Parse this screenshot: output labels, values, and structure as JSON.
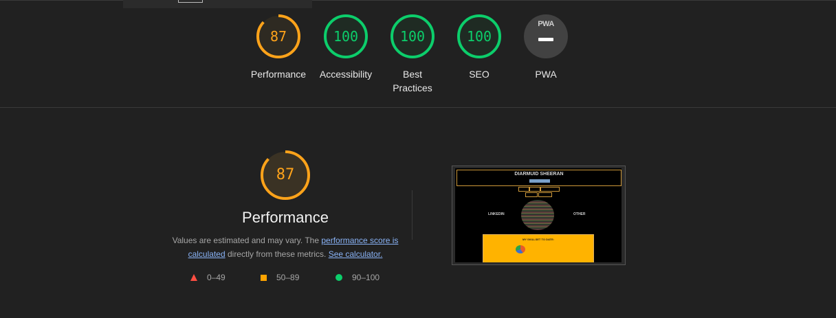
{
  "categories": [
    {
      "id": "performance",
      "score": "87",
      "label": "Performance",
      "value": 0.87,
      "color": "#ffa31a"
    },
    {
      "id": "accessibility",
      "score": "100",
      "label": "Accessibility",
      "value": 1.0,
      "color": "#0cce6b"
    },
    {
      "id": "best-practices",
      "score": "100",
      "label": "Best Practices",
      "value": 1.0,
      "color": "#0cce6b"
    },
    {
      "id": "seo",
      "score": "100",
      "label": "SEO",
      "value": 1.0,
      "color": "#0cce6b"
    },
    {
      "id": "pwa",
      "badge": "PWA",
      "label": "PWA",
      "icon": "pwa-dash-icon"
    }
  ],
  "performance": {
    "score": "87",
    "value": 0.87,
    "title": "Performance",
    "desc_prefix": "Values are estimated and may vary. The ",
    "link_score": "performance score is calculated",
    "desc_middle": " directly from these metrics. ",
    "link_calc": "See calculator."
  },
  "legend": [
    {
      "icon": "red-triangle-icon",
      "range": "0–49",
      "color": "#ff4e42"
    },
    {
      "icon": "orange-square-icon",
      "range": "50–89",
      "color": "#ffa400"
    },
    {
      "icon": "green-circle-icon",
      "range": "90–100",
      "color": "#0cce6b"
    }
  ],
  "screenshot": {
    "site_title": "DIARMUID SHEERAN",
    "left_link": "LINKEDIN",
    "right_link": "OTHER",
    "panel_title": "MY SKILLSET TO DATE:"
  }
}
